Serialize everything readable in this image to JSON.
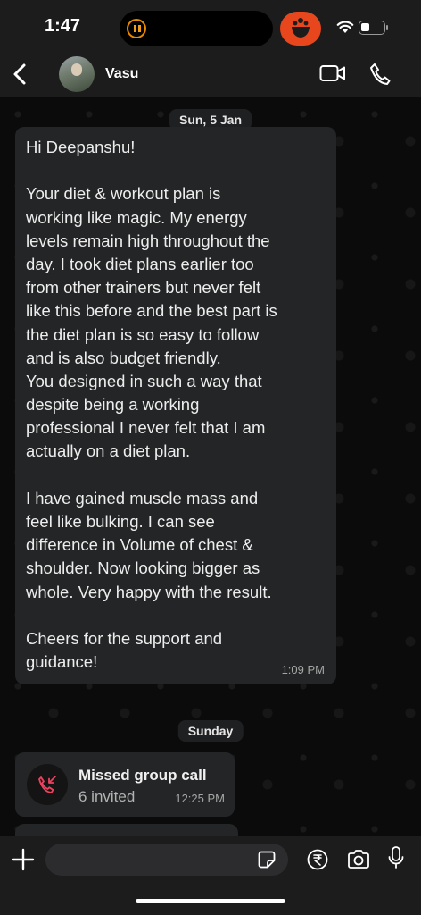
{
  "status_bar": {
    "time": "1:47",
    "icons": [
      "pause-icon",
      "food-app-icon",
      "wifi-icon",
      "battery-icon"
    ],
    "accent": "#e8461c"
  },
  "header": {
    "contact_name": "Vasu",
    "icons": [
      "back-chevron-icon",
      "video-call-icon",
      "phone-call-icon"
    ]
  },
  "chat": {
    "date_chip_1": "Sun, 5 Jan",
    "message": {
      "lines": [
        "Hi Deepanshu!",
        "",
        "Your diet & workout plan is",
        "working like magic. My energy",
        "levels remain high throughout the",
        "day. I took diet plans earlier too",
        "from other trainers but never felt",
        "like this before and the best part is",
        "the diet plan is so easy to follow",
        "and is also budget friendly.",
        "You designed in such a way that",
        "despite being a working",
        "professional I never felt that I am",
        "actually on a diet plan.",
        "",
        "I have gained muscle mass and",
        "feel like bulking. I can see",
        "difference in Volume of chest &",
        "shoulder. Now looking bigger as",
        "whole. Very happy with the result.",
        "",
        "Cheers for the support and",
        "guidance!"
      ],
      "time": "1:09 PM"
    },
    "date_chip_2": "Sunday",
    "missed_call": {
      "title": "Missed group call",
      "subtitle": "6 invited",
      "time": "12:25 PM",
      "icon": "missed-call-icon",
      "icon_color": "#e9435f"
    }
  },
  "input_bar": {
    "placeholder": "",
    "icons": [
      "plus-icon",
      "sticker-icon",
      "rupee-icon",
      "camera-icon",
      "mic-icon"
    ]
  }
}
